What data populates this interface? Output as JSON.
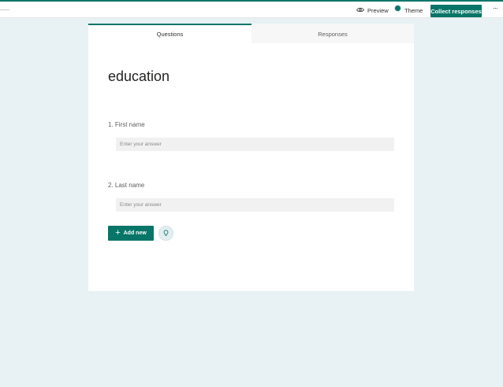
{
  "topbar": {
    "preview_label": "Preview",
    "theme_label": "Theme",
    "collect_label": "Collect responses",
    "more_label": "···"
  },
  "tabs": [
    {
      "label": "Questions",
      "active": true
    },
    {
      "label": "Responses",
      "active": false
    }
  ],
  "form": {
    "title": "education",
    "questions": [
      {
        "label": "1. First name",
        "placeholder": "Enter your answer"
      },
      {
        "label": "2. Last name",
        "placeholder": "Enter your answer"
      }
    ],
    "add_new_label": "Add new"
  },
  "colors": {
    "accent": "#077568",
    "background": "#e8f1f4"
  },
  "icons": {
    "preview": "eye-icon",
    "theme": "palette-icon",
    "add": "plus-icon",
    "insight": "lightbulb-icon"
  }
}
